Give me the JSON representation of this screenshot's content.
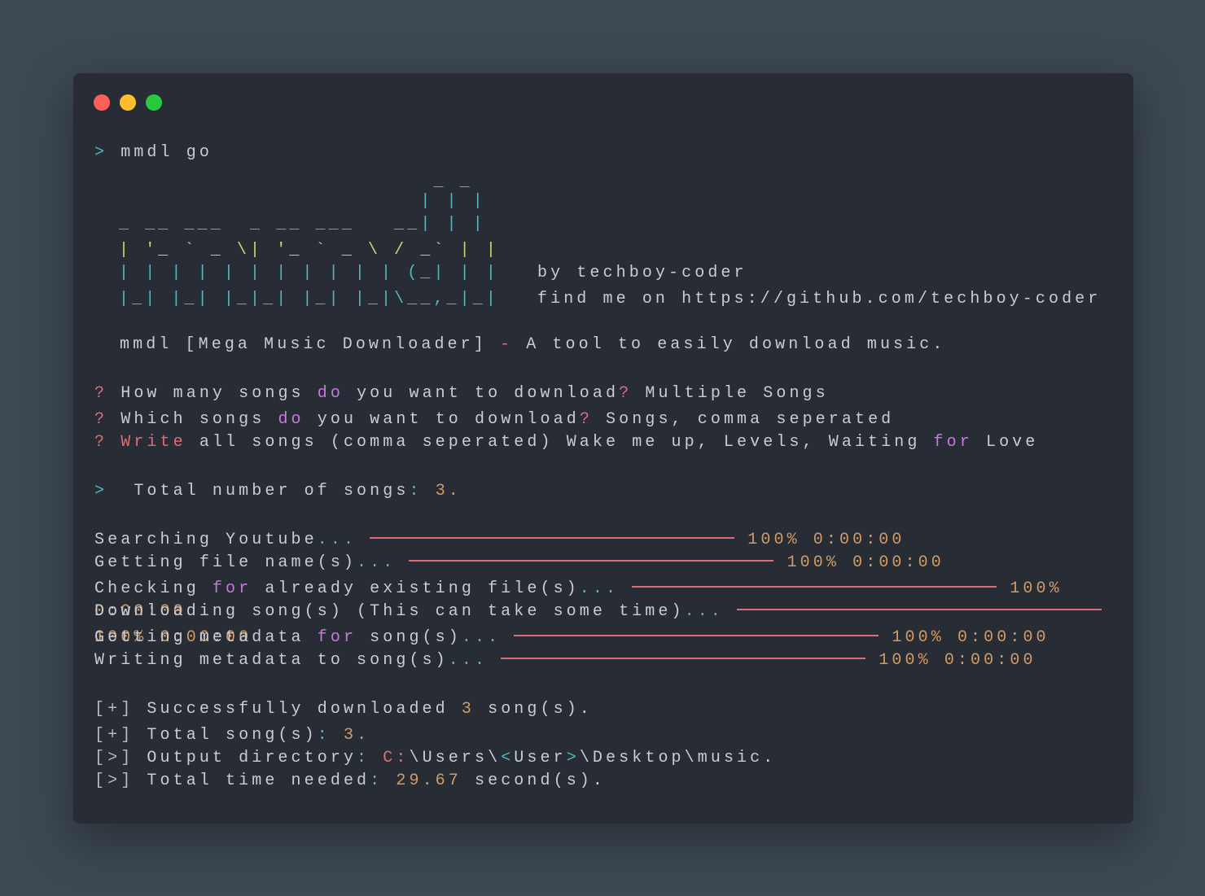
{
  "window": {
    "buttons": [
      "close",
      "minimize",
      "zoom"
    ]
  },
  "prompt": {
    "symbol": ">",
    "command": "mmdl go"
  },
  "ascii_art": [
    "                        _ _",
    "                       | | |",
    "_ __ ___  _ __ ___   __| | |",
    "| '_ ` _ \\| '_ ` _ \\ / _` | |",
    "| | | | | | | | | | | (_| | |",
    "|_| |_| |_|_| |_| |_|\\__,_|_|"
  ],
  "byline": "by techboy-coder",
  "find_me_prefix": "find me on ",
  "github_url": "https://github.com/techboy-coder",
  "tagline": {
    "name": "mmdl [Mega Music Downloader]",
    "dash": "-",
    "desc": "A tool to easily download music."
  },
  "questions": [
    {
      "mark": "?",
      "text_before": "How many songs ",
      "keyword": "do",
      "text_after": " you want to download",
      "qmark": "?",
      "answer": " Multiple Songs"
    },
    {
      "mark": "?",
      "text_before": "Which songs ",
      "keyword": "do",
      "text_after": " you want to download",
      "qmark": "?",
      "answer": " Songs, comma seperated"
    },
    {
      "mark": "?",
      "text_before": "",
      "keyword": "Write",
      "text_after": " all songs (comma seperated) Wake me up, Levels, Waiting ",
      "keyword2": "for",
      "answer": " Love"
    }
  ],
  "total": {
    "symbol": ">",
    "label": " Total number of songs",
    "colon": ":",
    "value": "3."
  },
  "progress": [
    {
      "label_a": "Searching Youtube",
      "dots": "...",
      "percent": "100%",
      "time": "0:00:00"
    },
    {
      "label_a": "Getting file name(s)",
      "dots": "...",
      "percent": "100%",
      "time": "0:00:00"
    },
    {
      "label_a": "Checking ",
      "keyword": "for",
      "label_b": " already existing file(s)",
      "dots": "...",
      "percent": "100%"
    },
    {
      "overlap": "0:00:00"
    },
    {
      "label_a": "Downloading song(s) (This can take some time)",
      "dots": "..."
    },
    {
      "overlap": "100% 0:00:00"
    },
    {
      "label_a": "Getting metadata ",
      "keyword": "for",
      "label_b": " song(s)",
      "dots": "...",
      "percent": "100%",
      "time": "0:00:00"
    },
    {
      "label_a": "Writing metadata to song(s)",
      "dots": "...",
      "percent": "100%",
      "time": "0:00:00"
    }
  ],
  "summary": {
    "success_prefix": "[+]",
    "success_text": " Successfully downloaded ",
    "success_count": "3",
    "success_suffix": " song(s).",
    "total_prefix": "[+]",
    "total_text": " Total song(s)",
    "total_colon": ":",
    "total_value": " 3.",
    "output_prefix": "[>]",
    "output_text": " Output directory",
    "output_colon": ":",
    "output_drive": " C:",
    "output_path_a": "\\Users\\",
    "output_lt": "<",
    "output_user": "User",
    "output_gt": ">",
    "output_path_b": "\\Desktop\\music.",
    "time_prefix": "[>]",
    "time_text": " Total time needed",
    "time_colon": ":",
    "time_value": " 29.67",
    "time_suffix": " second(s)."
  }
}
